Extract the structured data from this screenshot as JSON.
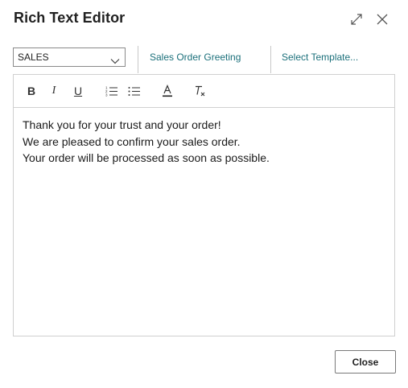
{
  "dialog": {
    "title": "Rich Text Editor",
    "icons": {
      "expand": "expand-icon",
      "close": "close-icon"
    }
  },
  "toolbar": {
    "select_value": "SALES",
    "greeting_link": "Sales Order Greeting",
    "template_link": "Select Template..."
  },
  "editor_toolbar": {
    "bold": "B",
    "italic": "I",
    "underline": "U",
    "ordered_list": "ordered-list-icon",
    "bullet_list": "bullet-list-icon",
    "font_color": "font-color-icon",
    "clear_format": "clear-formatting-icon"
  },
  "content": {
    "lines": [
      "Thank you for your trust and your order!",
      "We are pleased to confirm your sales order.",
      "Your order will be processed as soon as possible."
    ]
  },
  "footer": {
    "close_label": "Close"
  },
  "colors": {
    "link": "#1a6f7a",
    "font_color_bar": "#212121"
  }
}
